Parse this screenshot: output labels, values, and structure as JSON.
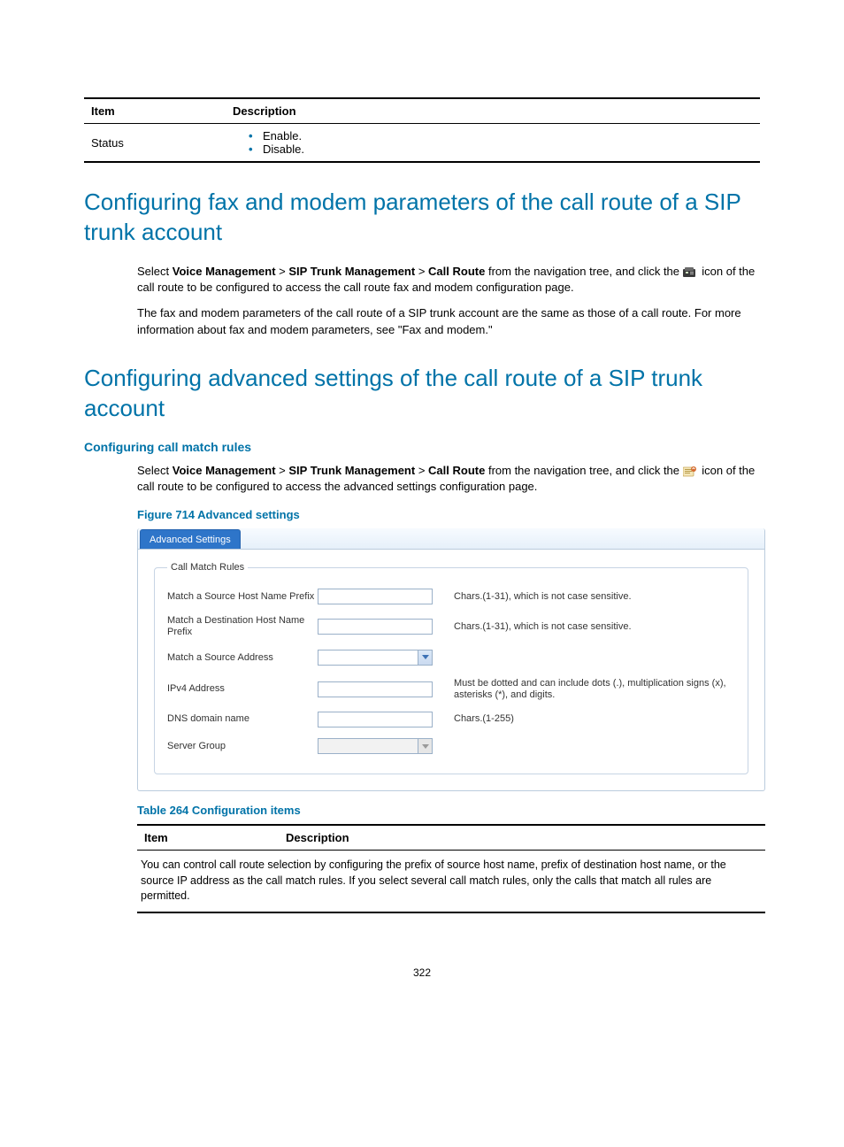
{
  "top_table": {
    "headers": {
      "item": "Item",
      "description": "Description"
    },
    "row": {
      "item": "Status",
      "opt1": "Enable.",
      "opt2": "Disable."
    }
  },
  "section1": {
    "title": "Configuring fax and modem parameters of the call route of a SIP trunk account",
    "p1_a": "Select ",
    "nav1": "Voice Management",
    "gt": " > ",
    "nav2": "SIP Trunk Management",
    "nav3": "Call Route",
    "p1_b": " from the navigation tree, and click the ",
    "p1_c": " icon of the call route to be configured to access the call route fax and modem configuration page.",
    "p2": "The fax and modem parameters of the call route of a SIP trunk account are the same as those of a call route. For more information about fax and modem parameters, see \"Fax and modem.\""
  },
  "section2": {
    "title": "Configuring advanced settings of the call route of a SIP trunk account",
    "sub": "Configuring call match rules",
    "p1_a": "Select ",
    "nav1": "Voice Management",
    "gt": " > ",
    "nav2": "SIP Trunk Management",
    "nav3": "Call Route",
    "p1_b": " from the navigation tree, and click the ",
    "p1_c": " icon of the call route to be configured to access the advanced settings configuration page.",
    "figcap": "Figure 714 Advanced settings"
  },
  "adv_panel": {
    "tab": "Advanced Settings",
    "legend": "Call Match Rules",
    "rows": [
      {
        "label": "Match a Source Host Name Prefix",
        "type": "text",
        "hint": "Chars.(1-31), which is not case sensitive."
      },
      {
        "label": "Match a Destination Host Name Prefix",
        "type": "text",
        "hint": "Chars.(1-31), which is not case sensitive."
      },
      {
        "label": "Match a Source Address",
        "type": "combo",
        "hint": ""
      },
      {
        "label": "IPv4 Address",
        "type": "text",
        "hint": "Must be dotted and can include dots (.), multiplication signs (x), asterisks (*), and digits."
      },
      {
        "label": "DNS domain name",
        "type": "text",
        "hint": "Chars.(1-255)"
      },
      {
        "label": "Server Group",
        "type": "combo_disabled",
        "hint": ""
      }
    ]
  },
  "conf_table": {
    "caption": "Table 264 Configuration items",
    "headers": {
      "item": "Item",
      "description": "Description"
    },
    "intro": "You can control call route selection by configuring the prefix of source host name, prefix of destination host name, or the source IP address as the call match rules. If you select several call match rules, only the calls that match all rules are permitted."
  },
  "page_number": "322"
}
